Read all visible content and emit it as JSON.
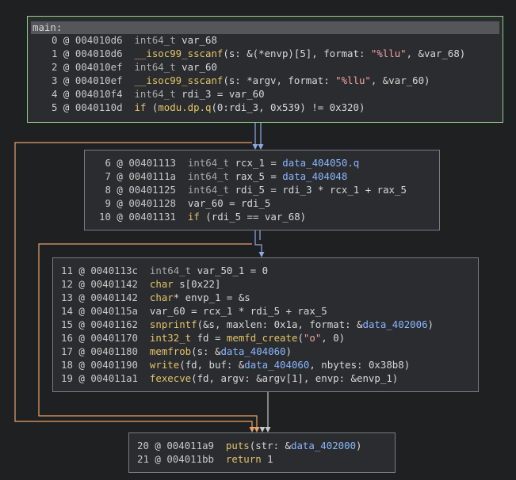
{
  "colors": {
    "background": "#1f2022",
    "block_bg": "#2b2c2f",
    "entry_border": "#8fd08a",
    "block_border": "#7a7b80",
    "edge_orange": "#e8a468",
    "edge_blue": "#8ea8e8",
    "edge_gray": "#c8c8c8",
    "call": "#e2c46a",
    "string": "#f2a2a2",
    "data_ref": "#8ab6ff"
  },
  "blocks": [
    {
      "title": "main:",
      "lines": [
        {
          "idx": "0",
          "addr": "004010d6",
          "parts": [
            [
              "type",
              "int64_t"
            ],
            [
              "plain",
              " var_68"
            ]
          ]
        },
        {
          "idx": "1",
          "addr": "004010d6",
          "parts": [
            [
              "fn",
              "__isoc99_sscanf"
            ],
            [
              "plain",
              "(s: &(*envp)[5], format: "
            ],
            [
              "str",
              "\"%llu\""
            ],
            [
              "plain",
              ", &var_68)"
            ]
          ]
        },
        {
          "idx": "2",
          "addr": "004010ef",
          "parts": [
            [
              "type",
              "int64_t"
            ],
            [
              "plain",
              " var_60"
            ]
          ]
        },
        {
          "idx": "3",
          "addr": "004010ef",
          "parts": [
            [
              "fn",
              "__isoc99_sscanf"
            ],
            [
              "plain",
              "(s: *argv, format: "
            ],
            [
              "str",
              "\"%llu\""
            ],
            [
              "plain",
              ", &var_60)"
            ]
          ]
        },
        {
          "idx": "4",
          "addr": "004010f4",
          "parts": [
            [
              "type",
              "int64_t"
            ],
            [
              "plain",
              " rdi_3 = var_60"
            ]
          ]
        },
        {
          "idx": "5",
          "addr": "0040110d",
          "parts": [
            [
              "kw",
              "if"
            ],
            [
              "plain",
              " ("
            ],
            [
              "fn",
              "modu.dp.q"
            ],
            [
              "plain",
              "(0:rdi_3, 0x539) != 0x320)"
            ]
          ]
        }
      ]
    },
    {
      "title": "",
      "lines": [
        {
          "idx": "6",
          "addr": "00401113",
          "parts": [
            [
              "type",
              "int64_t"
            ],
            [
              "plain",
              " rcx_1 = "
            ],
            [
              "data",
              "data_404050.q"
            ]
          ]
        },
        {
          "idx": "7",
          "addr": "0040111a",
          "parts": [
            [
              "type",
              "int64_t"
            ],
            [
              "plain",
              " rax_5 = "
            ],
            [
              "data",
              "data_404048"
            ]
          ]
        },
        {
          "idx": "8",
          "addr": "00401125",
          "parts": [
            [
              "type",
              "int64_t"
            ],
            [
              "plain",
              " rdi_5 = rdi_3 * rcx_1 + rax_5"
            ]
          ]
        },
        {
          "idx": "9",
          "addr": "00401128",
          "parts": [
            [
              "plain",
              "var_60 = rdi_5"
            ]
          ]
        },
        {
          "idx": "10",
          "addr": "00401131",
          "parts": [
            [
              "kw",
              "if"
            ],
            [
              "plain",
              " (rdi_5 == var_68)"
            ]
          ]
        }
      ]
    },
    {
      "title": "",
      "lines": [
        {
          "idx": "11",
          "addr": "0040113c",
          "parts": [
            [
              "type",
              "int64_t"
            ],
            [
              "plain",
              " var_50_1 = 0"
            ]
          ]
        },
        {
          "idx": "12",
          "addr": "00401142",
          "parts": [
            [
              "fn",
              "char"
            ],
            [
              "plain",
              " s[0x22]"
            ]
          ]
        },
        {
          "idx": "13",
          "addr": "00401142",
          "parts": [
            [
              "fn",
              "char"
            ],
            [
              "plain",
              "* envp_1 = &s"
            ]
          ]
        },
        {
          "idx": "14",
          "addr": "0040115a",
          "parts": [
            [
              "plain",
              "var_60 = rcx_1 * rdi_5 + rax_5"
            ]
          ]
        },
        {
          "idx": "15",
          "addr": "00401162",
          "parts": [
            [
              "fn",
              "snprintf"
            ],
            [
              "plain",
              "(&s, maxlen: 0x1a, format: &"
            ],
            [
              "data",
              "data_402006"
            ],
            [
              "plain",
              ")"
            ]
          ]
        },
        {
          "idx": "16",
          "addr": "00401170",
          "parts": [
            [
              "fn",
              "int32_t"
            ],
            [
              "plain",
              " fd = "
            ],
            [
              "fn",
              "memfd_create"
            ],
            [
              "plain",
              "("
            ],
            [
              "str",
              "\"o\""
            ],
            [
              "plain",
              ", 0)"
            ]
          ]
        },
        {
          "idx": "17",
          "addr": "00401180",
          "parts": [
            [
              "fn",
              "memfrob"
            ],
            [
              "plain",
              "(s: &"
            ],
            [
              "data",
              "data_404060"
            ],
            [
              "plain",
              ")"
            ]
          ]
        },
        {
          "idx": "18",
          "addr": "00401190",
          "parts": [
            [
              "fn",
              "write"
            ],
            [
              "plain",
              "(fd, buf: &"
            ],
            [
              "data",
              "data_404060"
            ],
            [
              "plain",
              ", nbytes: 0x38b8)"
            ]
          ]
        },
        {
          "idx": "19",
          "addr": "004011a1",
          "parts": [
            [
              "fn",
              "fexecve"
            ],
            [
              "plain",
              "(fd, argv: &argv[1], envp: &envp_1)"
            ]
          ]
        }
      ]
    },
    {
      "title": "",
      "lines": [
        {
          "idx": "20",
          "addr": "004011a9",
          "parts": [
            [
              "fn",
              "puts"
            ],
            [
              "plain",
              "(str: &"
            ],
            [
              "data",
              "data_402000"
            ],
            [
              "plain",
              ")"
            ]
          ]
        },
        {
          "idx": "21",
          "addr": "004011bb",
          "parts": [
            [
              "kw",
              "return"
            ],
            [
              "plain",
              " 1"
            ]
          ]
        }
      ]
    }
  ]
}
